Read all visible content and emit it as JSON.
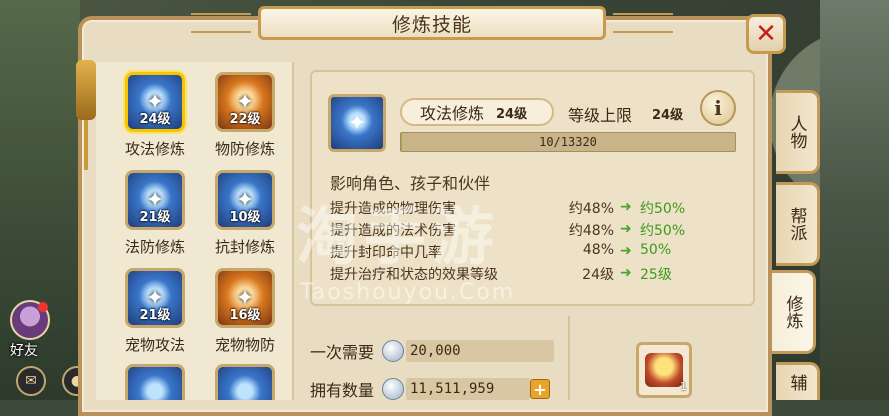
{
  "window": {
    "title": "修炼技能",
    "close_symbol": "✕"
  },
  "hud": {
    "friend_label": "好友"
  },
  "skills": [
    {
      "name": "攻法修炼",
      "level": "24级",
      "selected": true,
      "icon": "magic-attack-icon",
      "tone": "blue"
    },
    {
      "name": "物防修炼",
      "level": "22级",
      "selected": false,
      "icon": "physical-defense-icon",
      "tone": "orange"
    },
    {
      "name": "法防修炼",
      "level": "21级",
      "selected": false,
      "icon": "magic-defense-icon",
      "tone": "blue"
    },
    {
      "name": "抗封修炼",
      "level": "10级",
      "selected": false,
      "icon": "seal-resist-icon",
      "tone": "blue"
    },
    {
      "name": "宠物攻法",
      "level": "21级",
      "selected": false,
      "icon": "pet-magic-attack-icon",
      "tone": "blue"
    },
    {
      "name": "宠物物防",
      "level": "16级",
      "selected": false,
      "icon": "pet-physical-defense-icon",
      "tone": "orange"
    }
  ],
  "detail": {
    "skill_name": "攻法修炼",
    "skill_level": "24级",
    "cap_label": "等级上限",
    "cap_value": "24级",
    "info_symbol": "i",
    "progress_text": "10/13320",
    "progress_fraction": 0.00075,
    "effect_heading": "影响角色、孩子和伙伴",
    "effects": [
      {
        "label": "提升造成的物理伤害",
        "current": "约48%",
        "next": "约50%"
      },
      {
        "label": "提升造成的法术伤害",
        "current": "约48%",
        "next": "约50%"
      },
      {
        "label": "提升封印命中几率",
        "current": "48%",
        "next": "50%"
      },
      {
        "label": "提升治疗和状态的效果等级",
        "current": "24级",
        "next": "25级"
      }
    ]
  },
  "watermark": {
    "cn": "淘手游",
    "en": "Taoshouyou.Com"
  },
  "cost": {
    "need_label": "一次需要",
    "need_value": "20,000",
    "own_label": "拥有数量",
    "own_value": "11,511,959",
    "plus_symbol": "+"
  },
  "item": {
    "count": "1",
    "icon": "treasure-chest-icon"
  },
  "tabs": [
    {
      "label": "人物",
      "active": false
    },
    {
      "label": "帮派",
      "active": false
    },
    {
      "label": "修炼",
      "active": true
    },
    {
      "label": "辅",
      "active": false
    }
  ],
  "colors": {
    "panel_bg": "#e8dcc2",
    "frame": "#b8915b",
    "close_red": "#c9211a",
    "next_green": "#3e9a1e",
    "selected_gold": "#f6c400"
  }
}
